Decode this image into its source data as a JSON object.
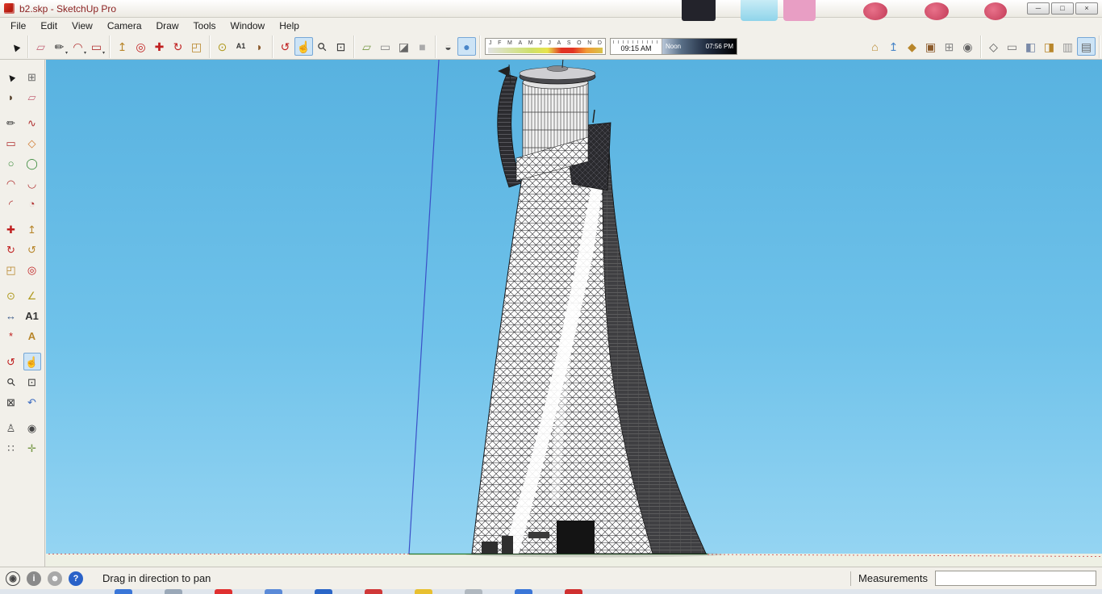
{
  "window": {
    "title": "b2.skp - SketchUp Pro",
    "controls": [
      {
        "name": "minimize-button",
        "glyph": "─"
      },
      {
        "name": "maximize-button",
        "glyph": "□"
      },
      {
        "name": "close-button",
        "glyph": "×"
      }
    ]
  },
  "menu": {
    "items": [
      "File",
      "Edit",
      "View",
      "Camera",
      "Draw",
      "Tools",
      "Window",
      "Help"
    ]
  },
  "toolbar_top": {
    "left_groups": [
      [
        {
          "name": "select-tool-icon",
          "glyph": "▲",
          "rot": -40,
          "color": "#1a1a1a"
        }
      ],
      [
        {
          "name": "eraser-tool-icon",
          "glyph": "▱",
          "color": "#c4687a"
        },
        {
          "name": "line-tool-icon",
          "glyph": "✏",
          "color": "#2a2a2a",
          "dropdown": true
        },
        {
          "name": "arc-tool-icon",
          "glyph": "◠",
          "color": "#b03030",
          "dropdown": true
        },
        {
          "name": "shape-tool-icon",
          "glyph": "▭",
          "color": "#b03030",
          "dropdown": true
        }
      ],
      [
        {
          "name": "push-pull-tool-icon",
          "glyph": "↥",
          "color": "#b8862b"
        },
        {
          "name": "offset-tool-icon",
          "glyph": "◎",
          "color": "#c02020"
        },
        {
          "name": "move-tool-icon",
          "glyph": "✚",
          "color": "#c02020"
        },
        {
          "name": "rotate-tool-icon",
          "glyph": "↻",
          "color": "#c02020"
        },
        {
          "name": "scale-tool-icon",
          "glyph": "◰",
          "color": "#b8862b"
        }
      ],
      [
        {
          "name": "tape-measure-tool-icon",
          "glyph": "⊙",
          "color": "#b09a20"
        },
        {
          "name": "text-tool-icon",
          "glyph": "A1",
          "color": "#333333",
          "small": true
        },
        {
          "name": "paint-bucket-tool-icon",
          "glyph": "◗",
          "color": "#8b5a2b"
        }
      ],
      [
        {
          "name": "orbit-tool-icon",
          "glyph": "↺",
          "color": "#c02020"
        },
        {
          "name": "pan-tool-icon",
          "glyph": "☝",
          "color": "#6b4f35",
          "active": true
        },
        {
          "name": "zoom-tool-icon",
          "glyph": "⚲",
          "rot": -45,
          "color": "#333333"
        },
        {
          "name": "zoom-extents-tool-icon",
          "glyph": "⊡",
          "color": "#333333"
        }
      ],
      [
        {
          "name": "section-plane-tool-icon",
          "glyph": "▱",
          "color": "#7a9a4a"
        },
        {
          "name": "display-section-planes-icon",
          "glyph": "▭",
          "color": "#888888"
        },
        {
          "name": "display-section-cuts-icon",
          "glyph": "◪",
          "color": "#666666"
        },
        {
          "name": "display-section-fill-icon",
          "glyph": "■",
          "color": "#aaaaaa"
        }
      ],
      [
        {
          "name": "xray-mode-icon",
          "glyph": "◒",
          "color": "#555555"
        },
        {
          "name": "shaded-with-textures-icon",
          "glyph": "●",
          "color": "#4a86c8",
          "active": true
        }
      ]
    ],
    "right_groups": [
      [
        {
          "name": "get-models-icon",
          "glyph": "⌂",
          "color": "#b8862b"
        },
        {
          "name": "share-model-icon",
          "glyph": "↥",
          "color": "#4a86c8"
        },
        {
          "name": "share-component-icon",
          "glyph": "◆",
          "color": "#b8862b"
        },
        {
          "name": "components-panel-icon",
          "glyph": "▣",
          "color": "#8b5a2b"
        },
        {
          "name": "extension-warehouse-icon",
          "glyph": "⊞",
          "color": "#888888"
        },
        {
          "name": "model-info-icon",
          "glyph": "◉",
          "color": "#666666"
        }
      ],
      [
        {
          "name": "wireframe-style-icon",
          "glyph": "◇",
          "color": "#555555"
        },
        {
          "name": "hidden-line-style-icon",
          "glyph": "▭",
          "color": "#777777"
        },
        {
          "name": "shaded-style-icon",
          "glyph": "◧",
          "color": "#7a8aa8"
        },
        {
          "name": "shaded-textures-style-icon",
          "glyph": "◨",
          "color": "#b8862b"
        },
        {
          "name": "monochrome-style-icon",
          "glyph": "▥",
          "color": "#999999"
        },
        {
          "name": "styles-panel-icon",
          "glyph": "▤",
          "color": "#666666",
          "active": true
        }
      ]
    ]
  },
  "shadow_toolbar": {
    "months": [
      "J",
      "F",
      "M",
      "A",
      "M",
      "J",
      "J",
      "A",
      "S",
      "O",
      "N",
      "D"
    ],
    "current_time": "09:15 AM",
    "noon_label": "Noon",
    "end_time": "07:56 PM"
  },
  "left_palette": {
    "groups": [
      [
        {
          "name": "select-tool-icon",
          "glyph": "▲",
          "rot": -40,
          "color": "#1a1a1a"
        },
        {
          "name": "make-component-icon",
          "glyph": "⊞",
          "color": "#6a6a6a"
        },
        {
          "name": "paint-bucket-icon",
          "glyph": "◗",
          "color": "#5a4630"
        },
        {
          "name": "eraser-icon",
          "glyph": "▱",
          "color": "#c4687a"
        }
      ],
      [
        {
          "name": "line-tool-icon",
          "glyph": "✏",
          "color": "#2a2a2a"
        },
        {
          "name": "freehand-tool-icon",
          "glyph": "∿",
          "color": "#b03030"
        },
        {
          "name": "rectangle-tool-icon",
          "glyph": "▭",
          "color": "#b03030"
        },
        {
          "name": "rotated-rectangle-tool-icon",
          "glyph": "◇",
          "color": "#d07a30"
        },
        {
          "name": "circle-tool-icon",
          "glyph": "○",
          "color": "#3a8a3a"
        },
        {
          "name": "polygon-tool-icon",
          "glyph": "◯",
          "color": "#3a8a3a"
        },
        {
          "name": "arc-tool-icon",
          "glyph": "◠",
          "color": "#b03030"
        },
        {
          "name": "two-point-arc-tool-icon",
          "glyph": "◡",
          "color": "#b03030"
        },
        {
          "name": "three-point-arc-tool-icon",
          "glyph": "◜",
          "color": "#b03030"
        },
        {
          "name": "pie-tool-icon",
          "glyph": "◔",
          "color": "#b03030"
        }
      ],
      [
        {
          "name": "move-tool-icon",
          "glyph": "✚",
          "color": "#c02020"
        },
        {
          "name": "push-pull-tool-icon",
          "glyph": "↥",
          "color": "#b8862b"
        },
        {
          "name": "rotate-tool-icon",
          "glyph": "↻",
          "color": "#c02020"
        },
        {
          "name": "follow-me-tool-icon",
          "glyph": "↺",
          "color": "#b8862b"
        },
        {
          "name": "scale-tool-icon",
          "glyph": "◰",
          "color": "#b8862b"
        },
        {
          "name": "offset-tool-icon",
          "glyph": "◎",
          "color": "#c02020"
        }
      ],
      [
        {
          "name": "tape-measure-tool-icon",
          "glyph": "⊙",
          "color": "#b09a20"
        },
        {
          "name": "protractor-tool-icon",
          "glyph": "∠",
          "color": "#b09a20"
        },
        {
          "name": "dimension-tool-icon",
          "glyph": "↔",
          "color": "#3a5a8a"
        },
        {
          "name": "text-tool-icon",
          "glyph": "A1",
          "color": "#333333",
          "small": true
        },
        {
          "name": "axes-tool-icon",
          "glyph": "*",
          "color": "#c02020"
        },
        {
          "name": "3d-text-tool-icon",
          "glyph": "A",
          "color": "#b8862b",
          "small": true
        }
      ],
      [
        {
          "name": "orbit-tool-icon",
          "glyph": "↺",
          "color": "#c02020"
        },
        {
          "name": "pan-tool-icon",
          "glyph": "☝",
          "color": "#6b4f35",
          "active": true
        },
        {
          "name": "zoom-tool-icon",
          "glyph": "⚲",
          "rot": -45,
          "color": "#333333"
        },
        {
          "name": "zoom-window-tool-icon",
          "glyph": "⊡",
          "color": "#333333"
        },
        {
          "name": "zoom-extents-tool-icon",
          "glyph": "⊠",
          "color": "#333333"
        },
        {
          "name": "previous-view-icon",
          "glyph": "↶",
          "color": "#3a6ac0"
        }
      ],
      [
        {
          "name": "position-camera-tool-icon",
          "glyph": "♙",
          "color": "#444444"
        },
        {
          "name": "look-around-tool-icon",
          "glyph": "◉",
          "color": "#444444"
        },
        {
          "name": "walk-tool-icon",
          "glyph": "∷",
          "color": "#444444"
        },
        {
          "name": "section-plane-icon",
          "glyph": "✛",
          "color": "#7a9a4a"
        }
      ]
    ]
  },
  "viewport": {
    "sky_top": "#58b2e0",
    "sky_bottom": "#94d4f2",
    "ground_color": "#eef0e4",
    "axis_blue": "#3a50c8",
    "axis_green": "#2a7a2a",
    "axis_red": "#cc6666"
  },
  "statusbar": {
    "icons": [
      {
        "name": "geo-location-icon",
        "glyph": "◉",
        "color": "#444444",
        "bg": ""
      },
      {
        "name": "info-icon",
        "glyph": "i",
        "color": "#ffffff",
        "bg": "#8a8a8a"
      },
      {
        "name": "account-avatar-icon",
        "glyph": "☻",
        "color": "#ffffff",
        "bg": "#a8a8a8"
      },
      {
        "name": "help-icon",
        "glyph": "?",
        "color": "#ffffff",
        "bg": "#2a62c8"
      }
    ],
    "hint": "Drag in direction to pan",
    "measurements_label": "Measurements",
    "measurements_value": ""
  },
  "taskbar": {
    "items": [
      {
        "name": "taskbar-app-1",
        "color": "#3a76d8"
      },
      {
        "name": "taskbar-app-2",
        "color": "#9aa8b8"
      },
      {
        "name": "taskbar-app-3",
        "color": "#e03030"
      },
      {
        "name": "taskbar-app-4",
        "color": "#5a8ad8"
      },
      {
        "name": "taskbar-app-5",
        "color": "#2a66c8"
      },
      {
        "name": "taskbar-app-6",
        "color": "#d03838"
      },
      {
        "name": "taskbar-app-7",
        "color": "#e8c030"
      },
      {
        "name": "taskbar-app-8",
        "color": "#b0b8c0"
      },
      {
        "name": "taskbar-app-9",
        "color": "#3a76d8"
      },
      {
        "name": "taskbar-app-10",
        "color": "#d03030"
      }
    ]
  }
}
